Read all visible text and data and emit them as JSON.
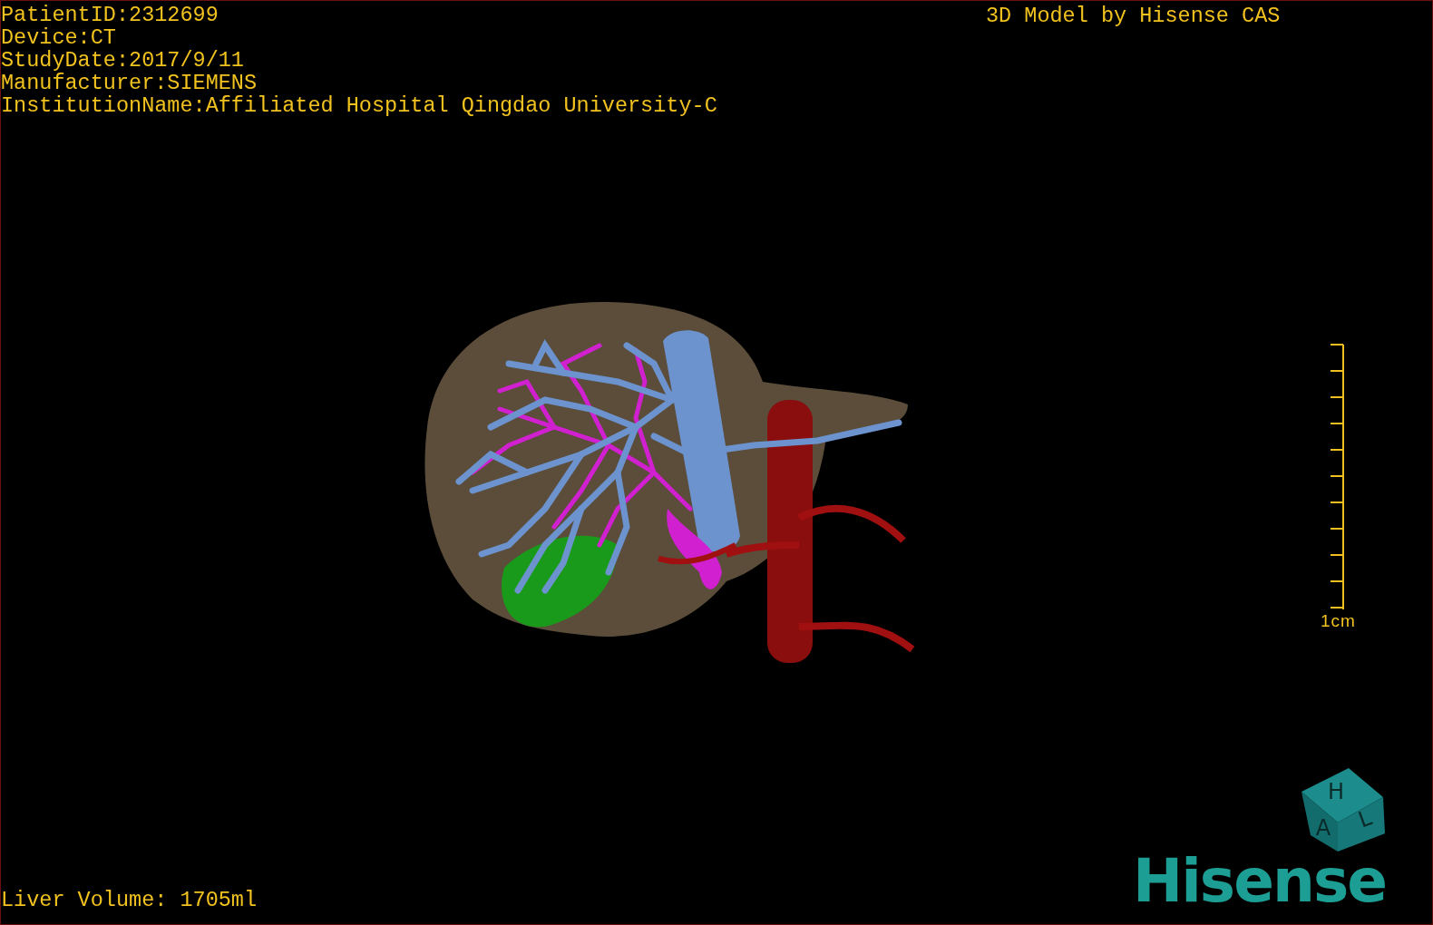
{
  "patient_info": [
    "PatientID:2312699",
    "Device:CT",
    "StudyDate:2017/9/11",
    "Manufacturer:SIEMENS",
    "InstitutionName:Affiliated Hospital Qingdao University-C"
  ],
  "header_title": "3D Model by Hisense CAS",
  "scale_bar": {
    "label": "1cm"
  },
  "orientation_cube": {
    "labels": [
      "H",
      "A",
      "L"
    ]
  },
  "logo": "Hisense",
  "liver_volume": "Liver Volume: 1705ml"
}
